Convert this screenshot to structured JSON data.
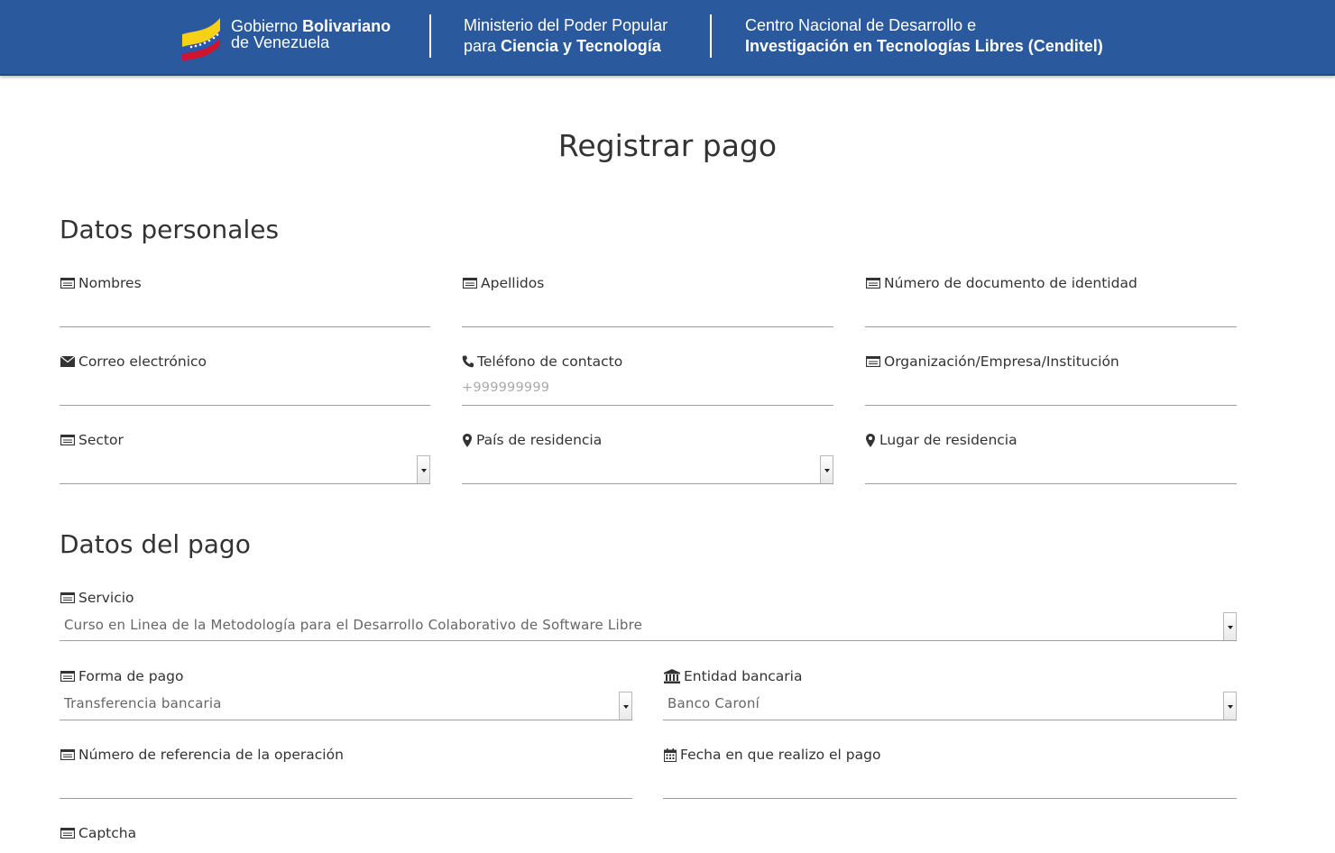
{
  "header": {
    "gov_line1_plain": "Gobierno ",
    "gov_line1_bold": "Bolivariano",
    "gov_line2": "de Venezuela",
    "ministry_line1": "Ministerio del Poder Popular",
    "ministry_line2_plain": "para ",
    "ministry_line2_bold": "Ciencia y Tecnología",
    "center_line1": "Centro Nacional de Desarrollo e",
    "center_line2": "Investigación en Tecnologías Libres (Cenditel)"
  },
  "page": {
    "title": "Registrar pago"
  },
  "personal": {
    "title": "Datos personales",
    "nombres": {
      "label": "Nombres",
      "value": ""
    },
    "apellidos": {
      "label": "Apellidos",
      "value": ""
    },
    "documento": {
      "label": "Número de documento de identidad",
      "value": ""
    },
    "correo": {
      "label": "Correo electrónico",
      "value": ""
    },
    "telefono": {
      "label": "Teléfono de contacto",
      "placeholder": "+999999999"
    },
    "organizacion": {
      "label": "Organización/Empresa/Institución",
      "value": ""
    },
    "sector": {
      "label": "Sector",
      "selected": ""
    },
    "pais": {
      "label": "País de residencia",
      "selected": ""
    },
    "lugar": {
      "label": "Lugar de residencia",
      "value": ""
    }
  },
  "payment": {
    "title": "Datos del pago",
    "servicio": {
      "label": "Servicio",
      "selected": "Curso en Linea de la Metodología para el Desarrollo Colaborativo de Software Libre"
    },
    "forma": {
      "label": "Forma de pago",
      "selected": "Transferencia bancaria"
    },
    "entidad": {
      "label": "Entidad bancaria",
      "selected": "Banco Caroní"
    },
    "referencia": {
      "label": "Número de referencia de la operación",
      "value": ""
    },
    "fecha": {
      "label": "Fecha en que realizo el pago",
      "value": ""
    },
    "captcha": {
      "label": "Captcha"
    }
  },
  "colors": {
    "header_bg": "#2a5a9d",
    "text": "#333333",
    "field_line": "#9e9e9e"
  },
  "icons": {
    "card": "id-card-icon",
    "envelope": "envelope-icon",
    "phone": "phone-icon",
    "marker": "map-marker-icon",
    "bank": "bank-icon",
    "calendar": "calendar-icon",
    "caret": "caret-down-icon"
  }
}
